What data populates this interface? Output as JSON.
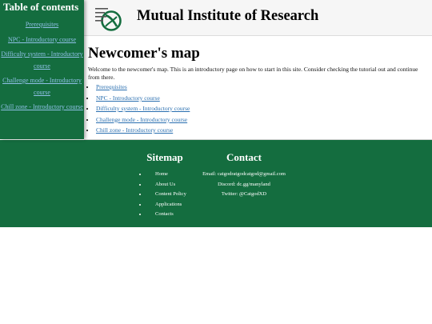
{
  "sidebar": {
    "title": "Table of contents",
    "items": [
      {
        "label": "Prerequisites"
      },
      {
        "label": "NPC - Introductory course"
      },
      {
        "label": "Difficulty system - Introductory course"
      },
      {
        "label": "Challenge mode - Introductory course"
      },
      {
        "label": "Chill zone - Introductory course"
      }
    ]
  },
  "header": {
    "title": "Mutual Institute of Research",
    "logo_text": "Mutual Institute of Research"
  },
  "main": {
    "title": "Newcomer's map",
    "intro": "Welcome to the newcomer's map. This is an introductory page on how to start in this site. Consider checking the tutorial out and continue from there.",
    "links": [
      {
        "label": "Prerequisites"
      },
      {
        "label": "NPC - Introductory course"
      },
      {
        "label": "Difficulty system - Introductory course"
      },
      {
        "label": "Challenge mode - Introductory course"
      },
      {
        "label": "Chill zone - Introductory course"
      }
    ]
  },
  "footer": {
    "sitemap": {
      "title": "Sitemap",
      "items": [
        {
          "label": "Home"
        },
        {
          "label": "About Us"
        },
        {
          "label": "Content Policy"
        },
        {
          "label": "Applications"
        },
        {
          "label": "Contacts"
        }
      ]
    },
    "contact": {
      "title": "Contact",
      "email": "Email: catgodratgodcatgod@gmail.com",
      "discord": "Discord: dc.gg/manyland",
      "twitter": "Twitter: @CatgodXD"
    }
  },
  "colors": {
    "brand_green": "#146d3f",
    "link_light": "#8fc0e6",
    "link": "#2a6fb0"
  }
}
